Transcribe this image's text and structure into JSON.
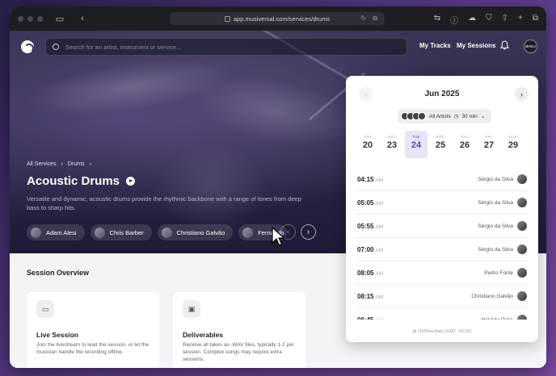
{
  "browser": {
    "url": "app.musiversal.com/services/drums"
  },
  "nav": {
    "search_placeholder": "Search for an artist, instrument or service...",
    "my_tracks": "My Tracks",
    "my_sessions": "My Sessions",
    "avatar_initials": "BHKU"
  },
  "hero": {
    "breadcrumb": [
      "All Services",
      "Drums"
    ],
    "title": "Acoustic Drums",
    "description": "Versatile and dynamic, acoustic drums provide the rhythmic backbone with a range of tones from deep bass to sharp hits.",
    "artists": [
      "Adam Alesi",
      "Chris Barber",
      "Christiano Galvão",
      "Fernando"
    ]
  },
  "overview": {
    "title": "Session Overview",
    "cards": [
      {
        "icon": "cast-icon",
        "title": "Live Session",
        "description": "Join the livestream to lead the session, or let the musician handle the recording offline."
      },
      {
        "icon": "folder-icon",
        "title": "Deliverables",
        "description": "Receive all takes as .WAV files, typically 1-2 per session. Complex songs may require extra sessions."
      }
    ]
  },
  "calendar": {
    "month": "Jun 2025",
    "filter_label": "All Artists",
    "filter_duration": "30 min",
    "days": [
      {
        "name": "FRI",
        "date": "20"
      },
      {
        "name": "SAT",
        "date": "23"
      },
      {
        "name": "TUE",
        "date": "24"
      },
      {
        "name": "WED",
        "date": "25"
      },
      {
        "name": "THU",
        "date": "26"
      },
      {
        "name": "FRI",
        "date": "27"
      },
      {
        "name": "SUN",
        "date": "29"
      }
    ],
    "selected_day_index": 2,
    "slots": [
      {
        "time": "04:15",
        "period": "AM",
        "artist": "Sérgio da Silva"
      },
      {
        "time": "05:05",
        "period": "AM",
        "artist": "Sérgio da Silva"
      },
      {
        "time": "05:55",
        "period": "AM",
        "artist": "Sérgio da Silva"
      },
      {
        "time": "07:00",
        "period": "AM",
        "artist": "Sérgio da Silva"
      },
      {
        "time": "08:05",
        "period": "AM",
        "artist": "Pedro Fonte"
      },
      {
        "time": "08:15",
        "period": "AM",
        "artist": "Christiano Galvão"
      },
      {
        "time": "06:45",
        "period": "AM",
        "artist": "Horácio Perís"
      }
    ],
    "timezone": "US/Mountain (GMT -06:00)"
  }
}
